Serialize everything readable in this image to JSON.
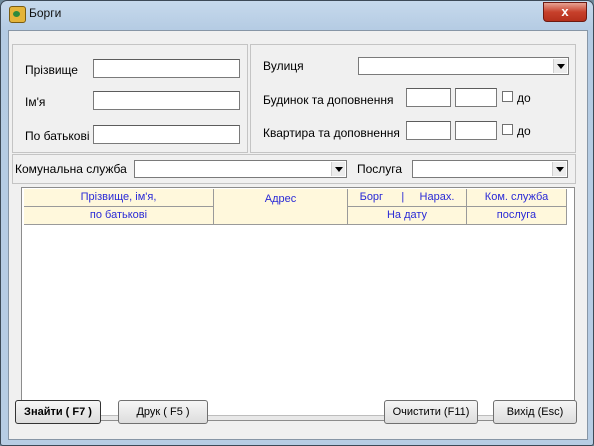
{
  "window": {
    "title": "Борги",
    "close_label": "x"
  },
  "search": {
    "surname_label": "Прізвище",
    "name_label": "Ім'я",
    "patronymic_label": "По батькові",
    "street_label": "Вулиця",
    "building_label": "Будинок та доповнення",
    "apartment_label": "Квартира та доповнення",
    "to_label": "до",
    "service_company_label": "Комунальна служба",
    "service_label": "Послуга",
    "surname_value": "",
    "name_value": "",
    "patronymic_value": "",
    "street_value": "",
    "service_company_value": "",
    "service_value": ""
  },
  "table": {
    "headers": {
      "name_row1": "Прізвище, ім'я,",
      "name_row2": "по батькові",
      "address": "Адрес",
      "debt": "Борг      |     Нарах.",
      "as_of_date": "На дату",
      "service_company": "Ком. служба",
      "service": "послуга"
    },
    "rows": []
  },
  "buttons": {
    "find": "Знайти ( F7 )",
    "print": "Друк ( F5 )",
    "clear": "Очистити (F11)",
    "exit": "Вихід (Esc)"
  }
}
